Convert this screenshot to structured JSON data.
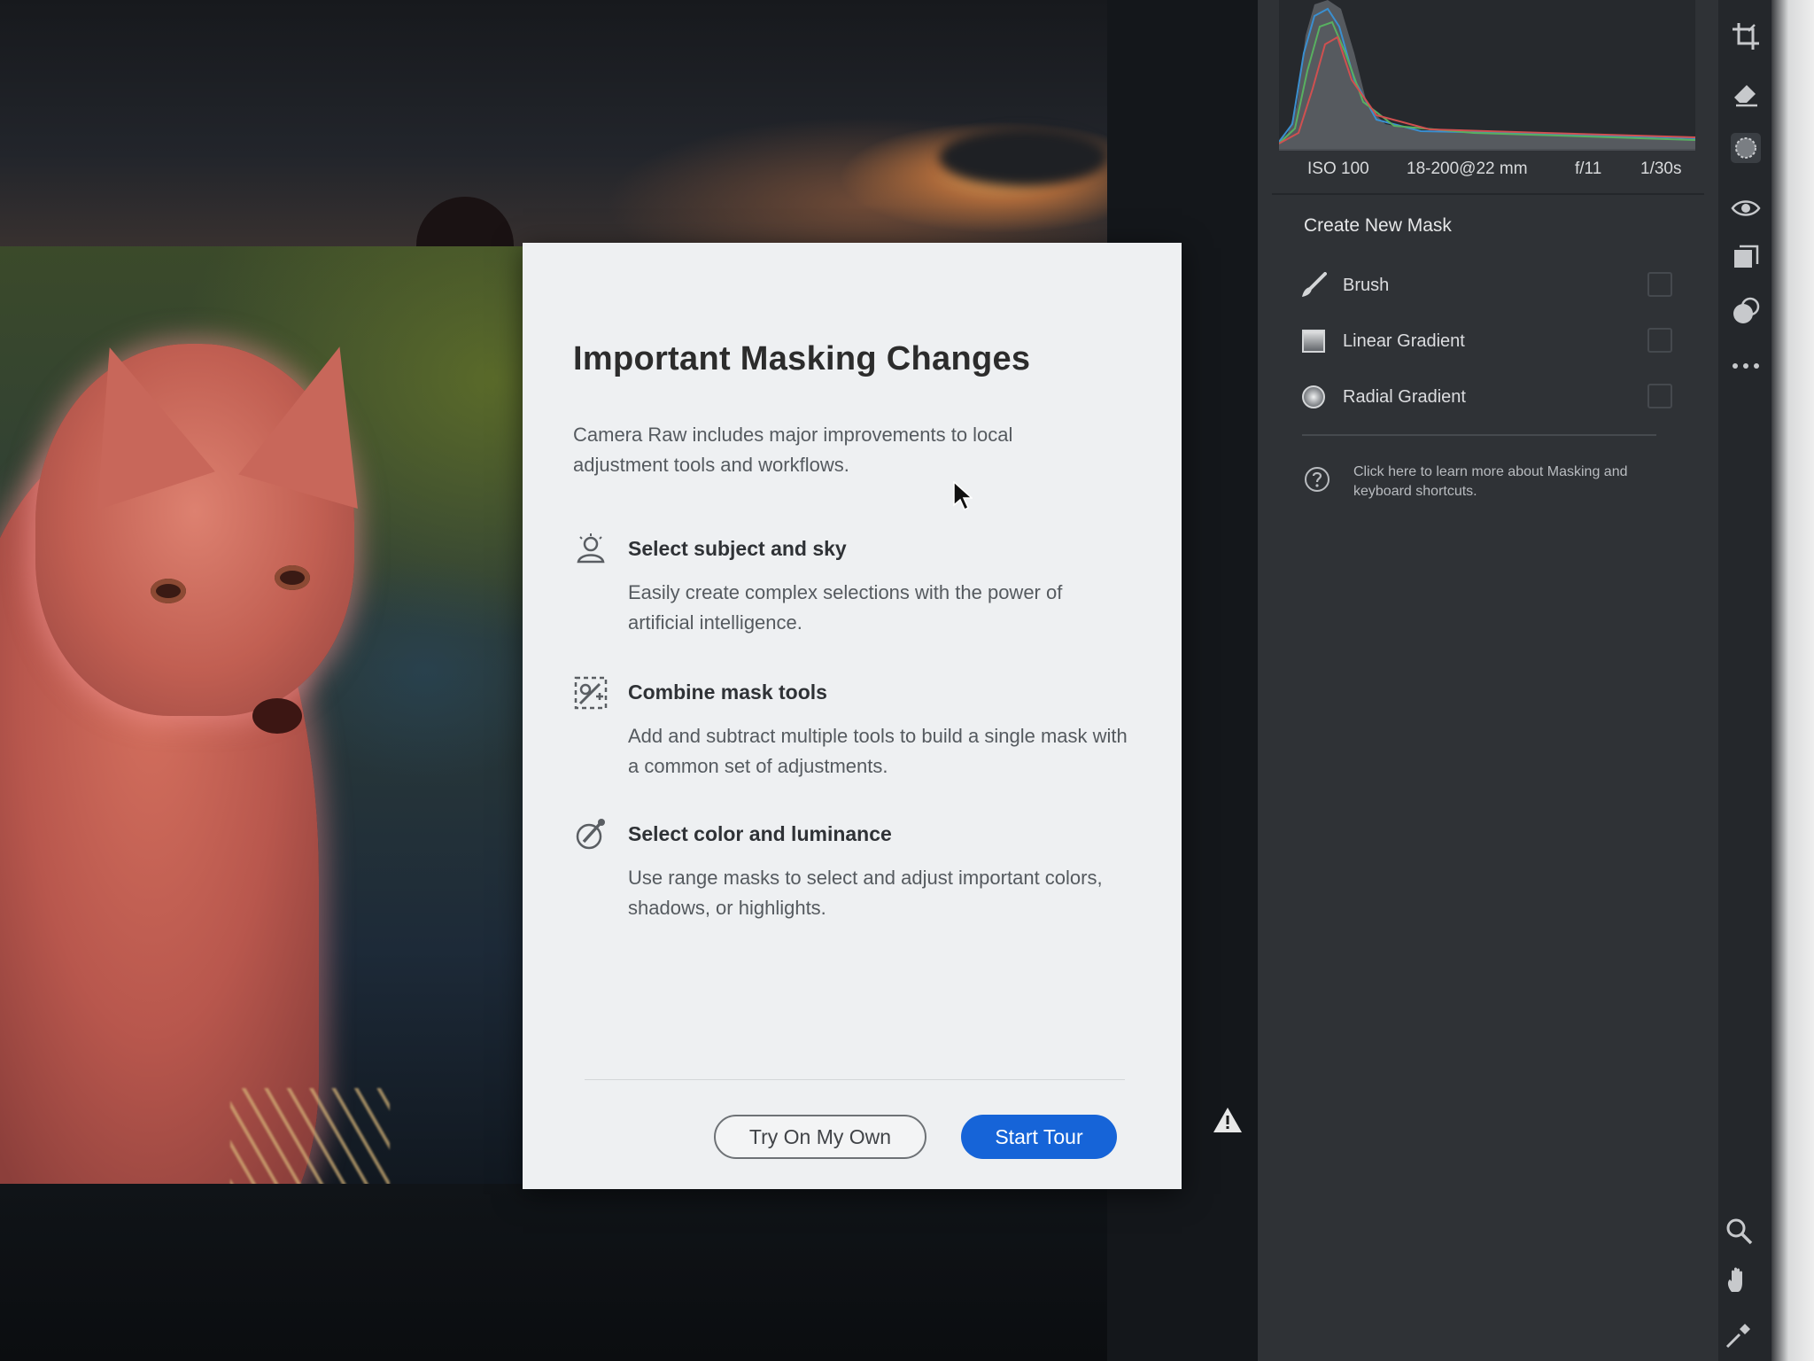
{
  "dialog": {
    "title": "Important Masking Changes",
    "intro": "Camera Raw includes major improvements to local adjustment tools and workflows.",
    "features": [
      {
        "icon": "person-icon",
        "title": "Select subject and sky",
        "description": "Easily create complex selections with the power of artificial intelligence."
      },
      {
        "icon": "combine-tools-icon",
        "title": "Combine mask tools",
        "description": "Add and subtract multiple tools to build a single mask with a common set of adjustments."
      },
      {
        "icon": "color-picker-icon",
        "title": "Select color and luminance",
        "description": "Use range masks to select and adjust important colors, shadows, or highlights."
      }
    ],
    "secondary_button": "Try On My Own",
    "primary_button": "Start Tour"
  },
  "exif": {
    "iso": "ISO 100",
    "lens": "18-200@22 mm",
    "aperture": "f/11",
    "shutter": "1/30s"
  },
  "mask_panel": {
    "section_title": "Create New Mask",
    "tools": [
      {
        "label": "Brush",
        "icon": "brush-icon"
      },
      {
        "label": "Linear Gradient",
        "icon": "linear-gradient-icon"
      },
      {
        "label": "Radial Gradient",
        "icon": "radial-gradient-icon"
      }
    ],
    "help_text": "Click here to learn more about Masking and keyboard shortcuts."
  },
  "toolbar_icons": [
    "crop-icon",
    "eraser-icon",
    "mask-icon",
    "red-eye-icon",
    "snapshots-icon",
    "presets-icon",
    "more-icon",
    "zoom-icon",
    "hand-icon",
    "sampler-icon"
  ],
  "colors": {
    "primary_button": "#1664d8",
    "panel_background": "#2f3236",
    "dialog_background": "#eef0f2",
    "mask_overlay": "#c15f52"
  }
}
